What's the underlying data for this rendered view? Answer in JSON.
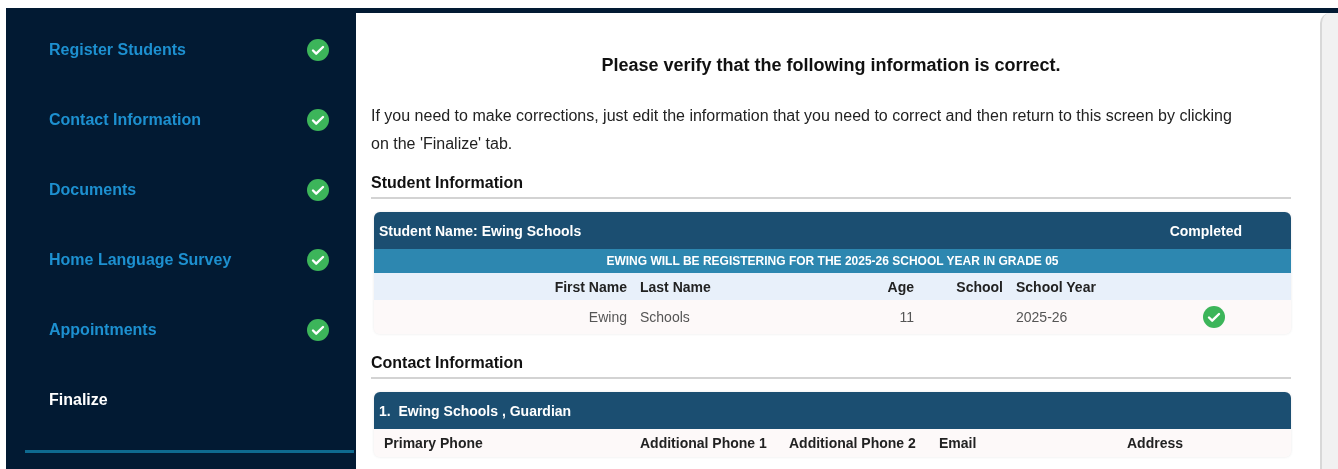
{
  "sidebar": {
    "items": [
      {
        "label": "Register Students",
        "completed": true,
        "selected": false
      },
      {
        "label": "Contact Information",
        "completed": true,
        "selected": false
      },
      {
        "label": "Documents",
        "completed": true,
        "selected": false
      },
      {
        "label": "Home Language Survey",
        "completed": true,
        "selected": false
      },
      {
        "label": "Appointments",
        "completed": true,
        "selected": false
      },
      {
        "label": "Finalize",
        "completed": false,
        "selected": true
      }
    ]
  },
  "main": {
    "title": "Please verify that the following information is correct.",
    "intro": "If you need to make corrections, just edit the information that you need to correct and then return to this screen by clicking on the 'Finalize' tab.",
    "student_section": {
      "heading": "Student Information",
      "card": {
        "title": "Student Name: Ewing Schools",
        "status": "Completed",
        "banner": "EWING WILL BE REGISTERING FOR THE 2025-26 SCHOOL YEAR IN GRADE 05",
        "columns": [
          "First Name",
          "Last Name",
          "Age",
          "School",
          "School Year"
        ],
        "rows": [
          {
            "first_name": "Ewing",
            "last_name": "Schools",
            "age": "11",
            "school_year": "2025-26",
            "completed": true
          }
        ]
      }
    },
    "contact_section": {
      "heading": "Contact Information",
      "card": {
        "title": "1.  Ewing Schools , Guardian",
        "columns": [
          "Primary Phone",
          "Additional Phone 1",
          "Additional Phone 2",
          "Email",
          "Address"
        ]
      }
    }
  }
}
